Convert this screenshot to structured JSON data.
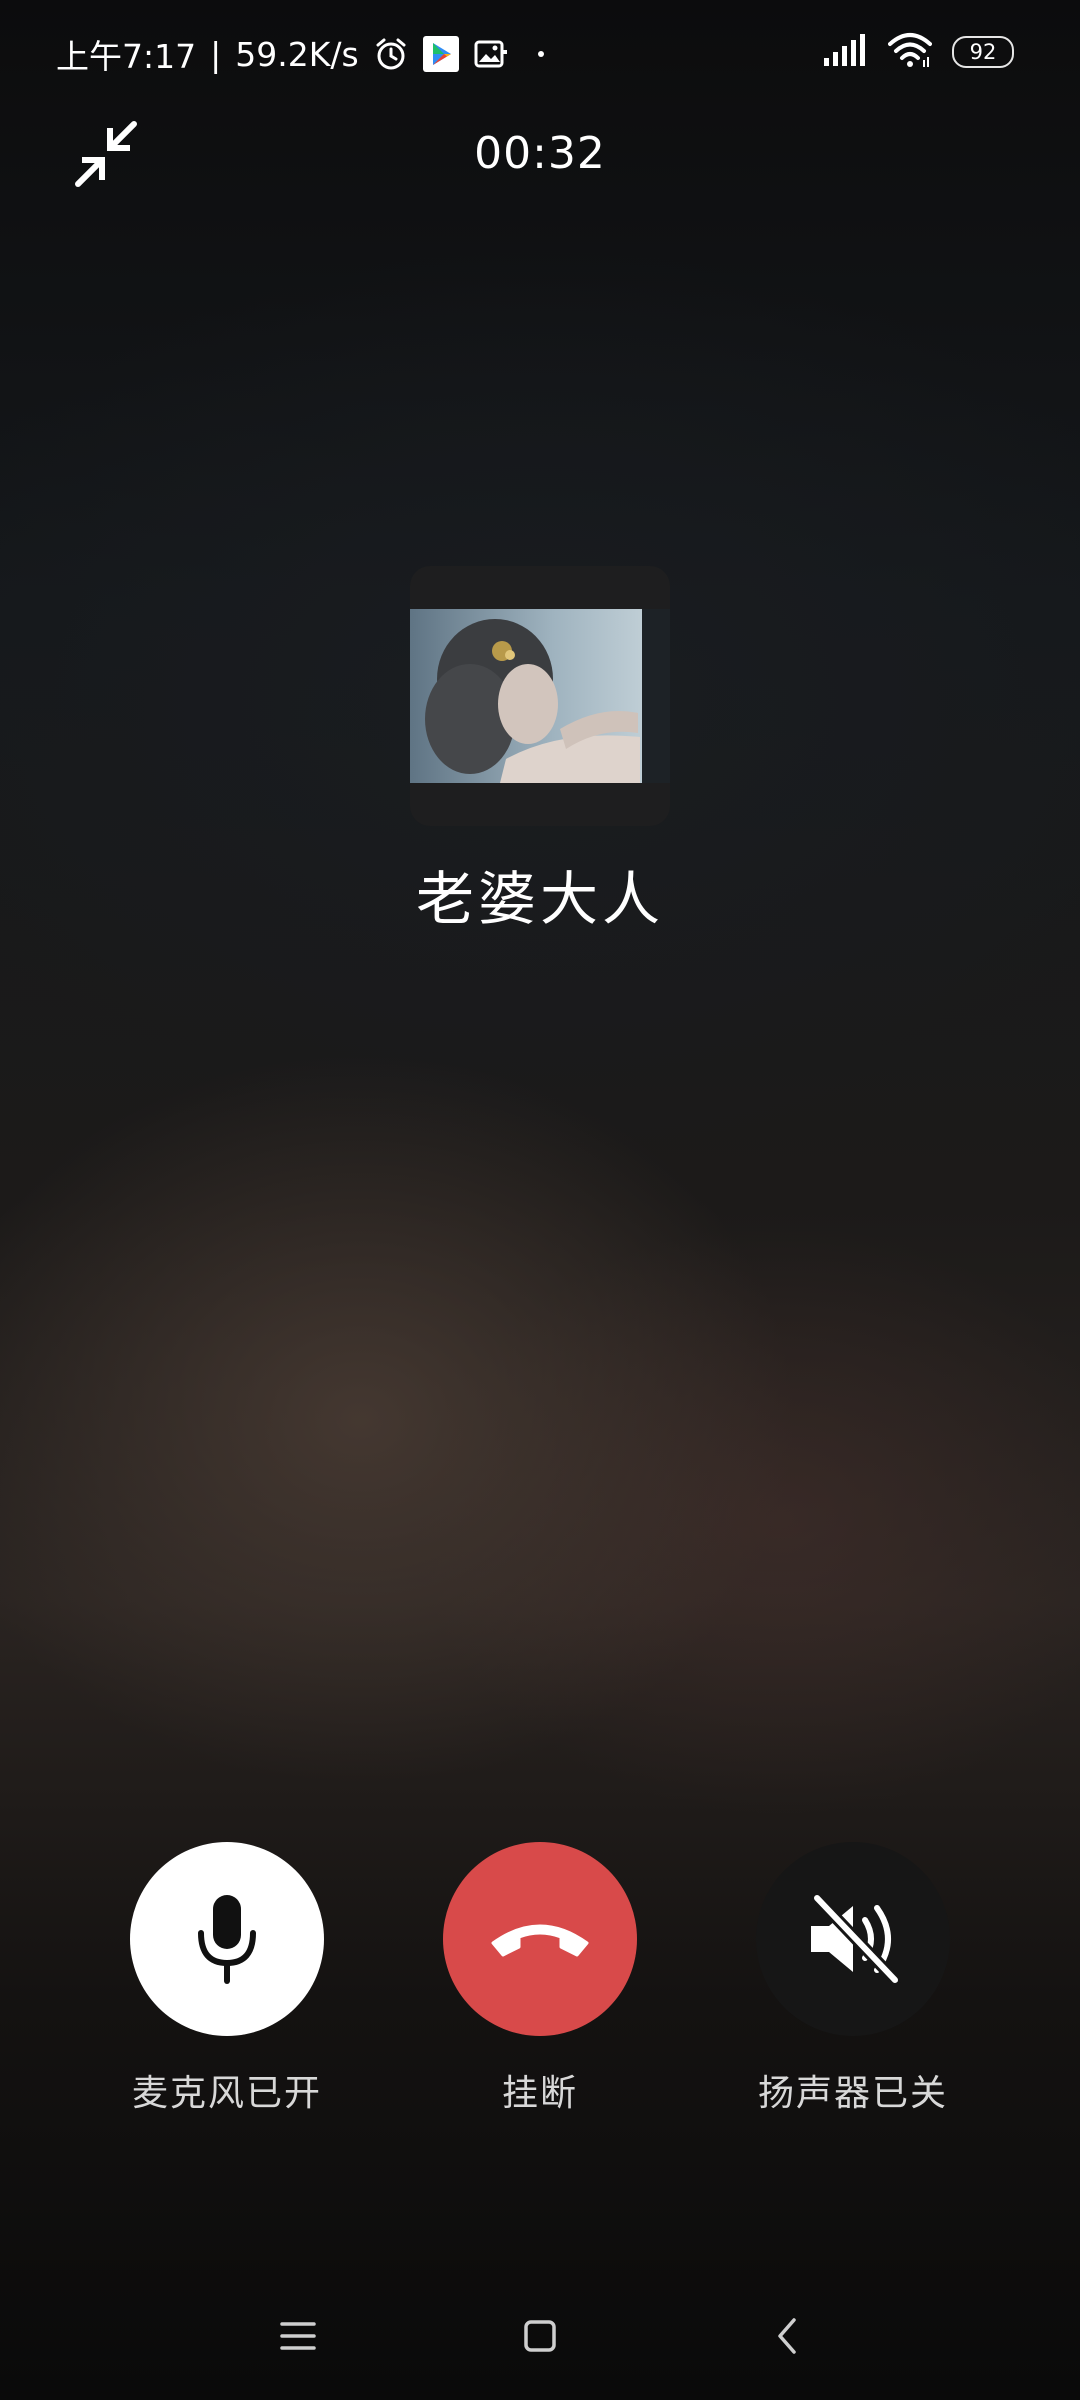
{
  "status_bar": {
    "time": "上午7:17",
    "separator": "|",
    "net_speed": "59.2K/s",
    "left_icons": [
      "alarm-icon",
      "play-store-icon",
      "gallery-icon",
      "dot-icon"
    ],
    "right_icons": [
      "signal-icon",
      "wifi-icon"
    ],
    "battery": "92"
  },
  "call": {
    "timer": "00:32",
    "contact_name": "老婆大人"
  },
  "controls": {
    "mic_label": "麦克风已开",
    "hangup_label": "挂断",
    "speaker_label": "扬声器已关"
  },
  "colors": {
    "hangup": "#d84a4a",
    "mic_active": "#ffffff",
    "speaker_inactive": "#161616"
  },
  "nav_bar": {
    "icons": [
      "menu-icon",
      "home-icon",
      "back-icon"
    ]
  }
}
